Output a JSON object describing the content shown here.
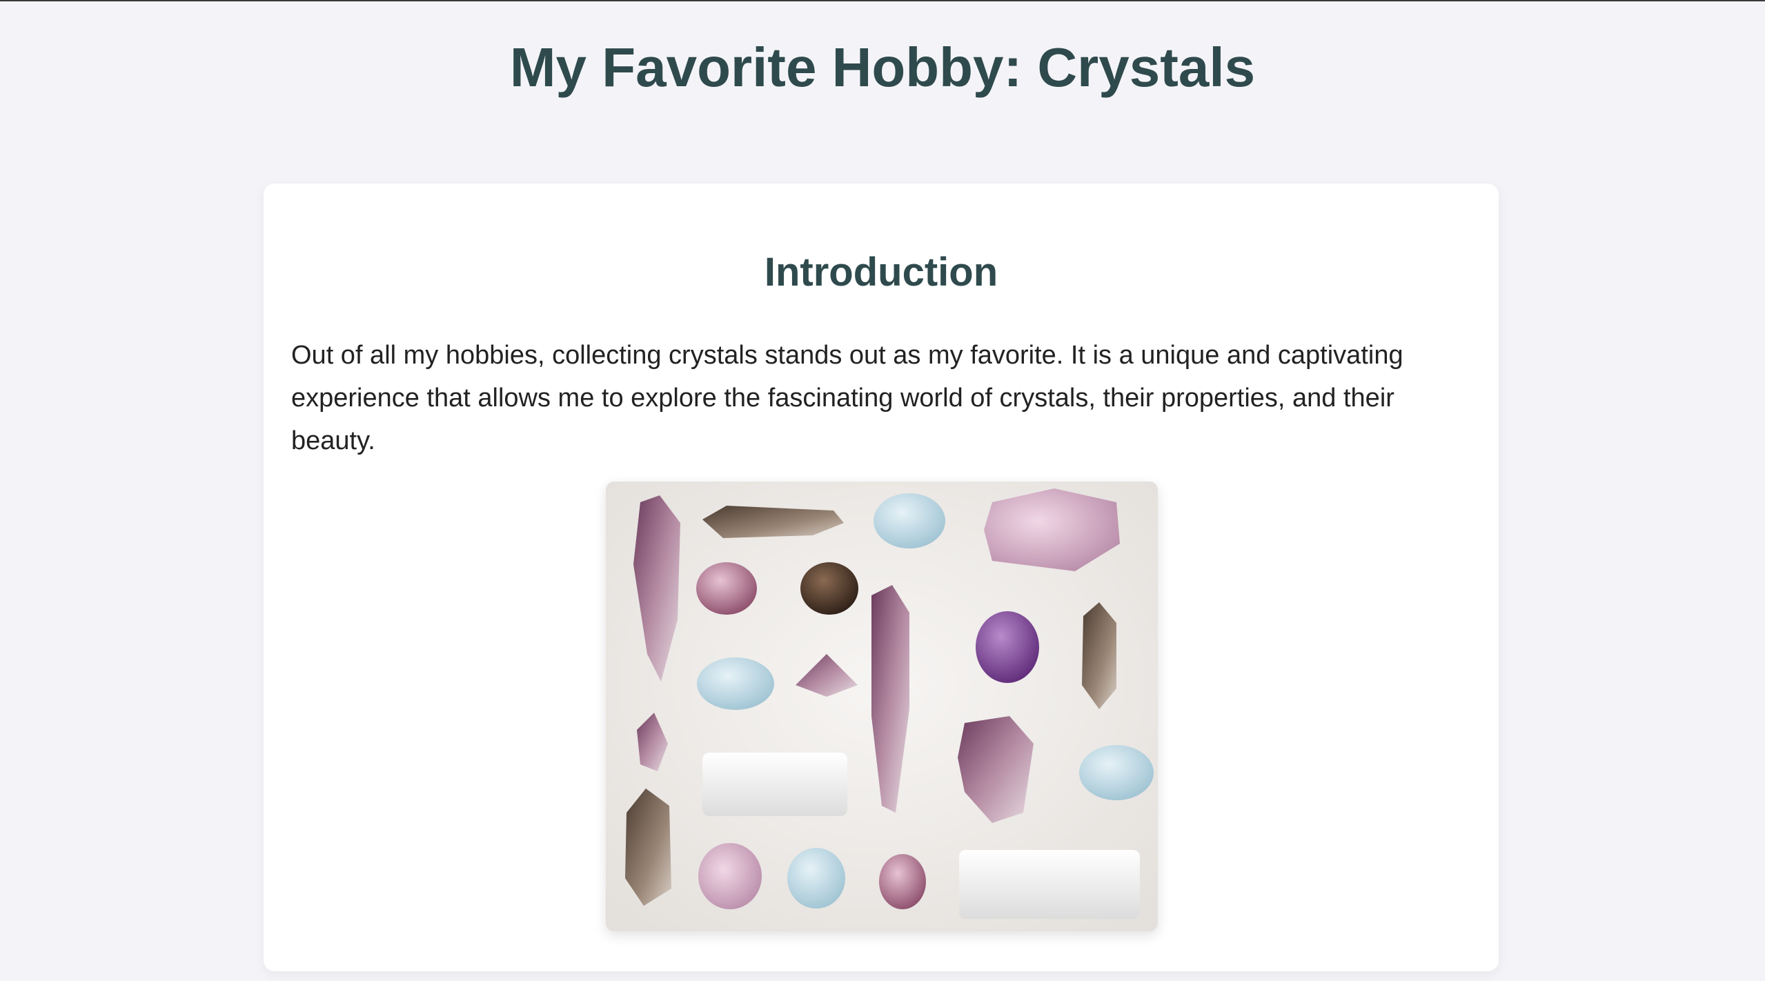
{
  "page": {
    "title": "My Favorite Hobby: Crystals"
  },
  "intro": {
    "heading": "Introduction",
    "paragraph": "Out of all my hobbies, collecting crystals stands out as my favorite. It is a unique and captivating experience that allows me to explore the fascinating world of crystals, their properties, and their beauty."
  },
  "image": {
    "subject": "crystal-collection-photo"
  },
  "colors": {
    "background": "#f4f4f8",
    "heading": "#2f4a4d",
    "text": "#222222",
    "card": "#ffffff"
  }
}
